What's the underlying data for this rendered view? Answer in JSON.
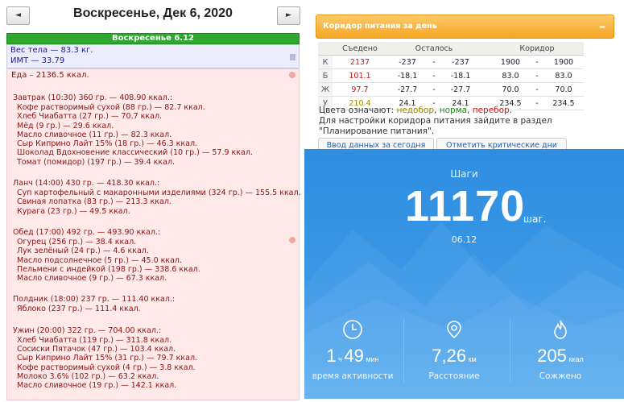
{
  "nav": {
    "prev": "◄",
    "next": "►"
  },
  "date_title": "Воскресенье, Дек 6, 2020",
  "day_bar": "Воскресенье 6.12",
  "body": {
    "weight": "Вес тела — 83.3 кг.",
    "bmi": "ИМТ — 33.79"
  },
  "food_total": "Еда – 2136.5 ккал.",
  "meals": [
    {
      "title": "Завтрак (10:30) 360 гр. — 408.90 ккал.:",
      "items": [
        "Кофе растворимый сухой (88 гр.) — 82.7 ккал.",
        "Хлеб Чиабатта (27 гр.) — 70.7 ккал.",
        "Мёд (9 гр.) — 29.6 ккал.",
        "Масло сливочное (11 гр.) — 82.3 ккал.",
        "Сыр Киприно Лайт 15% (18 гр.) — 46.3 ккал.",
        "Шоколад Вдохновение классический (10 гр.) — 57.9 ккал.",
        "Томат (помидор) (197 гр.) — 39.4 ккал."
      ]
    },
    {
      "title": "Ланч (14:00) 430 гр. — 418.30 ккал.:",
      "items": [
        "Суп картофельный с макаронными изделиями (324 гр.) — 155.5 ккал.",
        "Свиная лопатка (83 гр.) — 213.3 ккал.",
        "Курага (23 гр.) — 49.5 ккал."
      ]
    },
    {
      "title": "Обед (17:00) 492 гр. — 493.90 ккал.:",
      "items": [
        "Огурец (256 гр.) — 38.4 ккал.",
        "Лук зелёный (24 гр.) — 4.6 ккал.",
        "Масло подсолнечное (5 гр.) — 45.0 ккал.",
        "Пельмени с индейкой (198 гр.) — 338.6 ккал.",
        "Масло сливочное (9 гр.) — 67.3 ккал."
      ]
    },
    {
      "title": "Полдник (18:00) 237 гр. — 111.40 ккал.:",
      "items": [
        "Яблоко (237 гр.) — 111.4 ккал."
      ]
    },
    {
      "title": "Ужин (20:00) 322 гр. — 704.00 ккал.:",
      "items": [
        "Хлеб Чиабатта (119 гр.) — 311.8 ккал.",
        "Сосиски Пятачок (47 гр.) — 103.4 ккал.",
        "Сыр Киприно Лайт 15% (31 гр.) — 79.7 ккал.",
        "Кофе растворимый сухой (4 гр.) — 3.8 ккал.",
        "Молоко 3.6% (102 гр.) — 63.2 ккал.",
        "Масло сливочное (19 гр.) — 142.1 ккал."
      ]
    }
  ],
  "corridor": {
    "title": "Коридор питания за день",
    "collapse": "–",
    "headers": {
      "eaten": "Съедено",
      "left": "Осталось",
      "corridor": "Коридор"
    },
    "rows": [
      {
        "label": "К",
        "eaten": "2137",
        "eaten_color": "#c01b1b",
        "left_min": "-237",
        "left_max": "-237",
        "corr_min": "1900",
        "corr_max": "1900"
      },
      {
        "label": "Б",
        "eaten": "101.1",
        "eaten_color": "#c01b1b",
        "left_min": "-18.1",
        "left_max": "-18.1",
        "corr_min": "83.0",
        "corr_max": "83.0"
      },
      {
        "label": "Ж",
        "eaten": "97.7",
        "eaten_color": "#c01b1b",
        "left_min": "-27.7",
        "left_max": "-27.7",
        "corr_min": "70.0",
        "corr_max": "70.0"
      },
      {
        "label": "У",
        "eaten": "210.4",
        "eaten_color": "#9a8a00",
        "left_min": "24.1",
        "left_max": "24.1",
        "corr_min": "234.5",
        "corr_max": "234.5"
      }
    ],
    "dash": "-",
    "legend": {
      "prefix": "Цвета означают: ",
      "under": "недобор",
      "sep1": ", ",
      "norm": "норма",
      "sep2": ", ",
      "over": "перебор",
      "end": ".",
      "note": "Для настройки коридора питания зайдите в раздел \"Планирование питания\"."
    },
    "btn_input": "Ввод данных за сегодня",
    "btn_mark": "Отметить критические дни"
  },
  "steps": {
    "label": "Шаги",
    "value": "11170",
    "unit": "шаг.",
    "date": "06.12",
    "time_h": "1",
    "time_h_unit": "ч",
    "time_m": "49",
    "time_m_unit": "мин",
    "time_label": "время активности",
    "distance": "7,26",
    "distance_unit": "км",
    "distance_label": "Расстояние",
    "calories": "205",
    "calories_unit": "ккал",
    "calories_label": "Сожжено"
  }
}
